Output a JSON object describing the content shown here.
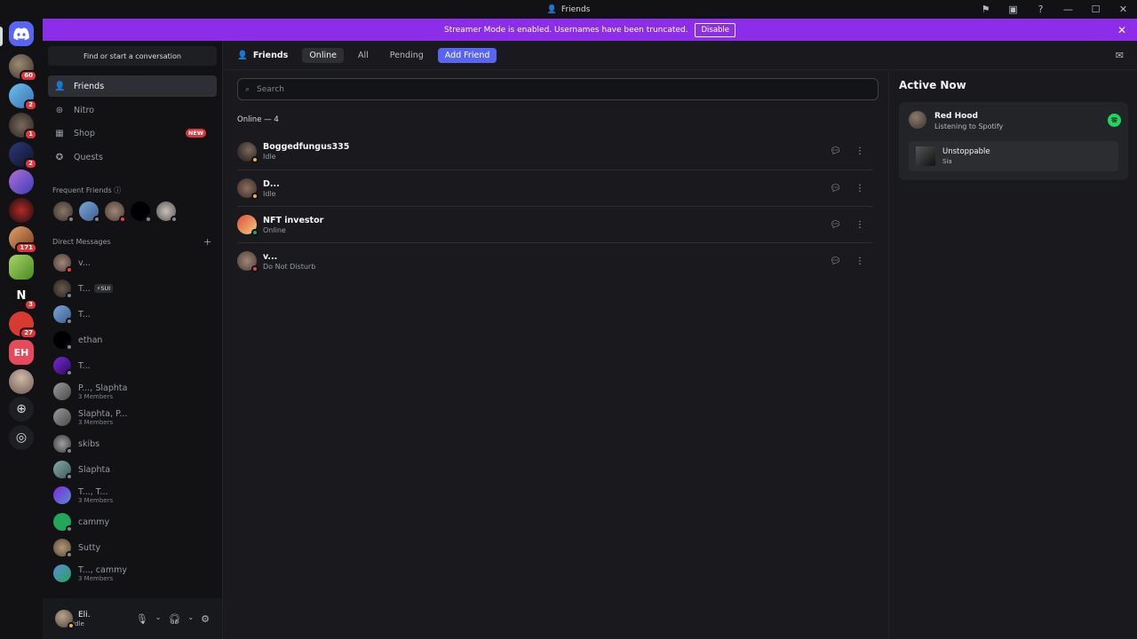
{
  "window": {
    "title": "Friends"
  },
  "banner": {
    "text": "Streamer Mode is enabled. Usernames have been truncated.",
    "button": "Disable"
  },
  "servers": [
    {
      "badge": "60"
    },
    {
      "badge": "2"
    },
    {
      "badge": "1"
    },
    {
      "badge": "2"
    },
    {
      "badge": ""
    },
    {
      "badge": ""
    },
    {
      "badge": "171"
    },
    {
      "badge": ""
    },
    {
      "badge": "3"
    },
    {
      "badge": "27"
    },
    {
      "badge": ""
    },
    {
      "badge": ""
    }
  ],
  "sidebar": {
    "search_placeholder": "Find or start a conversation",
    "nav": [
      {
        "label": "Friends",
        "icon": "friends-icon"
      },
      {
        "label": "Nitro",
        "icon": "nitro-icon"
      },
      {
        "label": "Shop",
        "icon": "shop-icon",
        "badge": "NEW"
      },
      {
        "label": "Quests",
        "icon": "quests-icon"
      }
    ],
    "frequent_label": "Frequent Friends",
    "dm_label": "Direct Messages",
    "dms": [
      {
        "name": "v...",
        "sub": "",
        "status": "dnd"
      },
      {
        "name": "T...",
        "sub": "",
        "tag": "⚡SUI",
        "status": "offline"
      },
      {
        "name": "T...",
        "sub": "",
        "status": "offline"
      },
      {
        "name": "ethan",
        "sub": "",
        "status": "offline"
      },
      {
        "name": "T...",
        "sub": "",
        "status": "offline"
      },
      {
        "name": "P..., Slaphta",
        "sub": "3 Members"
      },
      {
        "name": "Slaphta, P...",
        "sub": "3 Members"
      },
      {
        "name": "skibs",
        "sub": "",
        "status": "offline"
      },
      {
        "name": "Slaphta",
        "sub": "",
        "status": "offline"
      },
      {
        "name": "T..., T...",
        "sub": "3 Members"
      },
      {
        "name": "cammy",
        "sub": "",
        "status": "offline"
      },
      {
        "name": "Sutty",
        "sub": "",
        "status": "offline"
      },
      {
        "name": "T..., cammy",
        "sub": "3 Members"
      }
    ]
  },
  "user": {
    "name": "Eli.",
    "status": "Idle"
  },
  "topbar": {
    "title": "Friends",
    "tabs": [
      "Online",
      "All",
      "Pending"
    ],
    "add_friend": "Add Friend"
  },
  "search": {
    "placeholder": "Search"
  },
  "online_header": "Online — 4",
  "friends": [
    {
      "name": "Boggedfungus335",
      "status": "Idle",
      "dot": "idle"
    },
    {
      "name": "D...",
      "status": "Idle",
      "dot": "idle"
    },
    {
      "name": "NFT investor",
      "status": "Online",
      "dot": "online"
    },
    {
      "name": "v...",
      "status": "Do Not Disturb",
      "dot": "dnd"
    }
  ],
  "active_now": {
    "title": "Active Now",
    "name": "Red Hood",
    "activity": "Listening to Spotify",
    "song": "Unstoppable",
    "artist": "Sia"
  },
  "colors": {
    "brand": "#5865f2",
    "banner": "#8c2ee9",
    "spotify": "#1ed760"
  }
}
